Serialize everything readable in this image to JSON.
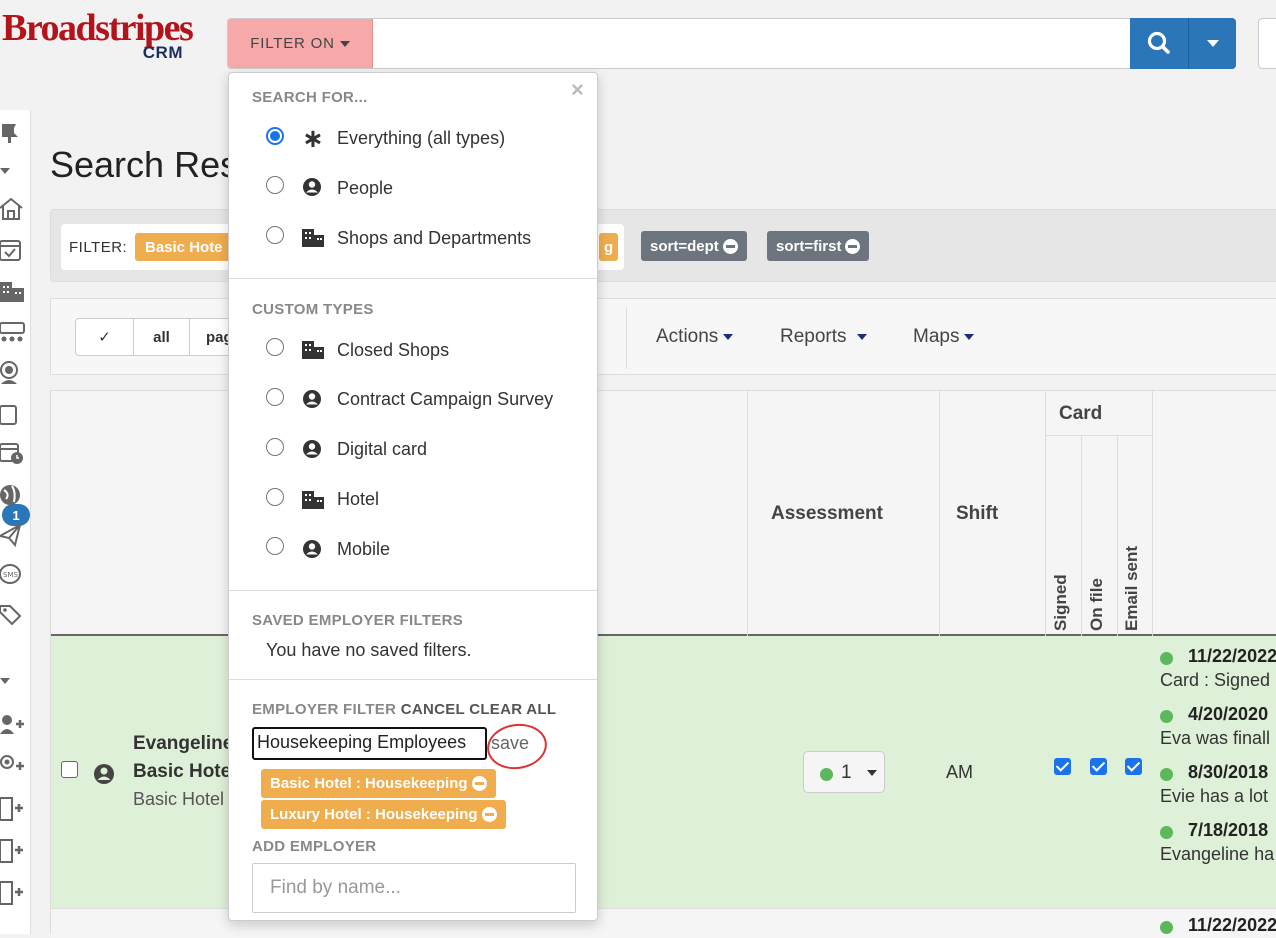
{
  "logo": {
    "line1": "Broadstripes",
    "line2": "CRM"
  },
  "search": {
    "filter_label": "FILTER ON",
    "value": ""
  },
  "sidebar": {
    "badge_count": "1"
  },
  "main": {
    "title": "Search Res",
    "filter_label": "FILTER:",
    "filter_chip_1": "Basic Hote",
    "filter_chip_2": "g",
    "sort_chip_1": "sort=dept",
    "sort_chip_2": "sort=first"
  },
  "toolbar": {
    "check_label": "✓",
    "all_label": "all",
    "page_label": "pag",
    "actions": "Actions",
    "reports": "Reports",
    "maps": "Maps"
  },
  "table": {
    "headers": {
      "assessment": "Assessment",
      "shift": "Shift",
      "card": "Card",
      "signed": "Signed",
      "on_file": "On file",
      "email_sent": "Email sent"
    },
    "row1": {
      "name_line1": "Evangeline",
      "name_line2": "Basic Hote",
      "name_line3": "Basic Hotel",
      "assessment": "1",
      "shift": "AM",
      "signed": true,
      "on_file": true,
      "email_sent": true,
      "activities": [
        {
          "date": "11/22/2022",
          "text": "Card : Signed"
        },
        {
          "date": "4/20/2020",
          "text": "Eva was finall"
        },
        {
          "date": "8/30/2018",
          "text": "Evie has a lot"
        },
        {
          "date": "7/18/2018",
          "text": "Evangeline ha"
        }
      ]
    },
    "row2": {
      "date": "11/22/2022"
    }
  },
  "popup": {
    "search_for_heading": "SEARCH FOR...",
    "search_options": [
      {
        "label": "Everything (all types)",
        "icon": "asterisk-icon",
        "selected": true
      },
      {
        "label": "People",
        "icon": "person-icon",
        "selected": false
      },
      {
        "label": "Shops and Departments",
        "icon": "building-icon",
        "selected": false
      }
    ],
    "custom_types_heading": "CUSTOM TYPES",
    "custom_types": [
      {
        "label": "Closed Shops",
        "icon": "building-icon"
      },
      {
        "label": "Contract Campaign Survey",
        "icon": "person-icon"
      },
      {
        "label": "Digital card",
        "icon": "person-icon"
      },
      {
        "label": "Hotel",
        "icon": "building-icon"
      },
      {
        "label": "Mobile",
        "icon": "person-icon"
      }
    ],
    "saved_heading": "SAVED EMPLOYER FILTERS",
    "saved_empty": "You have no saved filters.",
    "employer_filter_heading": "EMPLOYER FILTER",
    "cancel_label": "CANCEL",
    "clear_all_label": "CLEAR ALL",
    "filter_name_value": "Housekeeping Employees",
    "save_label": "save",
    "employer_chips": [
      "Basic Hotel : Housekeeping",
      "Luxury Hotel : Housekeeping"
    ],
    "add_employer_heading": "ADD EMPLOYER",
    "add_employer_placeholder": "Find by name..."
  },
  "colors": {
    "accent_blue": "#2b76b9",
    "filter_on_bg": "#f7a8a8",
    "chip_orange": "#f0ad4e",
    "chip_grey": "#6c757d",
    "row_green": "#dff0d8"
  }
}
